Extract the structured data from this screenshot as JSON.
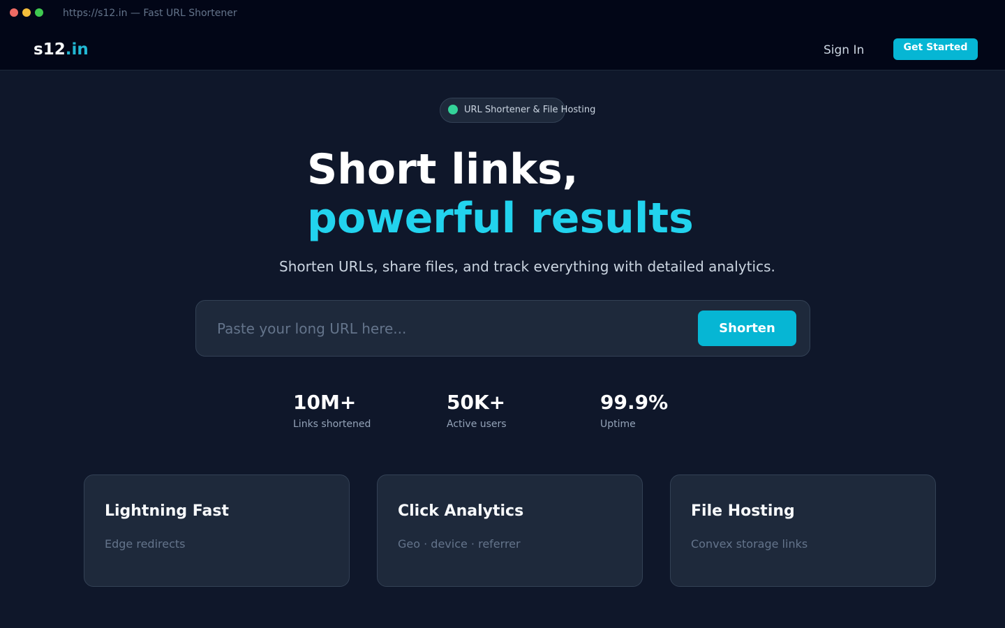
{
  "browser": {
    "title": "https://s12.in — Fast URL Shortener"
  },
  "nav": {
    "logo_main": "s12",
    "logo_accent": ".in",
    "signin_label": "Sign In",
    "cta_label": "Get Started"
  },
  "badge": {
    "text": "URL Shortener & File Hosting"
  },
  "hero": {
    "line1": "Short links,",
    "line2": "powerful results",
    "subtitle": "Shorten URLs, share files, and track everything with detailed analytics."
  },
  "shorten": {
    "placeholder": "Paste your long URL here...",
    "value": "",
    "button_label": "Shorten"
  },
  "stats": [
    {
      "value": "10M+",
      "label": "Links shortened"
    },
    {
      "value": "50K+",
      "label": "Active users"
    },
    {
      "value": "99.9%",
      "label": "Uptime"
    }
  ],
  "features": [
    {
      "title": "Lightning Fast",
      "description": "Edge redirects"
    },
    {
      "title": "Click Analytics",
      "description": "Geo · device · referrer"
    },
    {
      "title": "File Hosting",
      "description": "Convex storage links"
    }
  ],
  "colors": {
    "background": "#0f172a",
    "nav_background": "#020617",
    "accent": "#06b6d4",
    "accent_text": "#22d3ee",
    "status_dot": "#34d399"
  }
}
